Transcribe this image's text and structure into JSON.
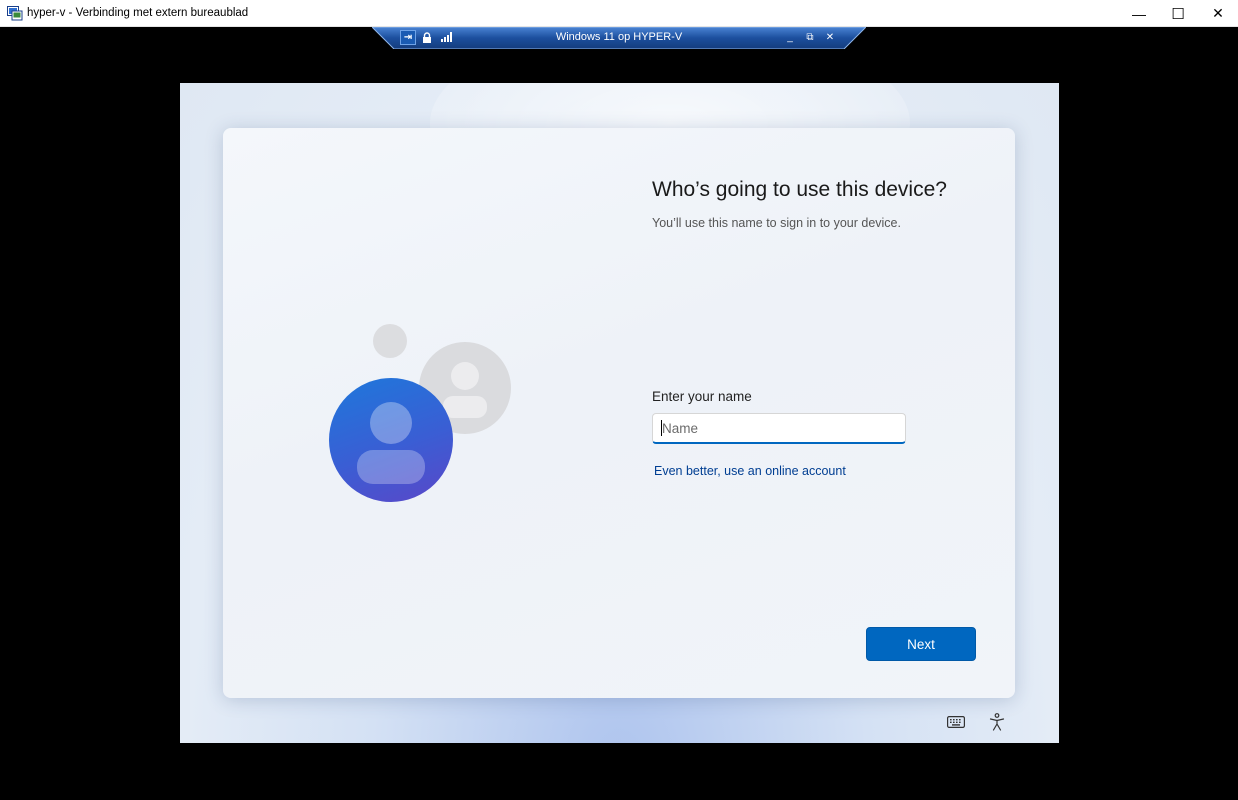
{
  "window": {
    "title": "hyper-v - Verbinding met extern bureaublad",
    "minimize_glyph": "—",
    "maximize_glyph": "☐",
    "close_glyph": "✕"
  },
  "connection_bar": {
    "title": "Windows 11 op HYPER-V",
    "pin_glyph": "⇥",
    "lock_icon": "lock-icon",
    "signal_icon": "signal-icon",
    "minimize_glyph": "_",
    "restore_glyph": "⧉",
    "close_glyph": "✕"
  },
  "oobe": {
    "heading": "Who’s going to use this device?",
    "subtext": "You’ll use this name to sign in to your device.",
    "name_label": "Enter your name",
    "name_placeholder": "Name",
    "name_value": "",
    "online_account_link": "Even better, use an online account",
    "next_label": "Next"
  },
  "footer_icons": [
    "keyboard-icon",
    "accessibility-icon"
  ],
  "colors": {
    "accent": "#0067c0",
    "link": "#003e92",
    "background": "#000000"
  }
}
